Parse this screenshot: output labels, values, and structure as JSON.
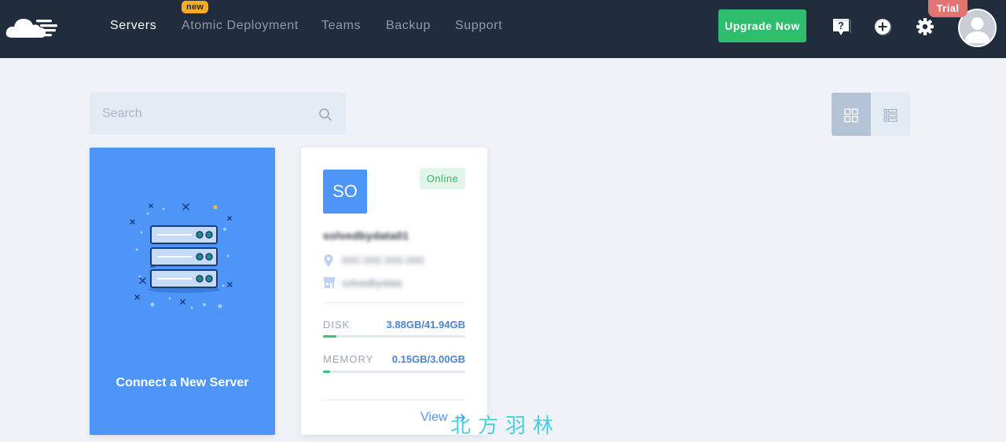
{
  "nav": {
    "items": [
      {
        "label": "Servers",
        "active": true
      },
      {
        "label": "Atomic Deployment",
        "badge": "new"
      },
      {
        "label": "Teams"
      },
      {
        "label": "Backup"
      },
      {
        "label": "Support"
      }
    ],
    "upgrade_label": "Upgrade Now",
    "icons": [
      "help-icon",
      "add-circle-icon",
      "gear-icon"
    ],
    "trial_badge": "Trial",
    "avatar_icon": "user-avatar-icon",
    "logo_icon": "cloud-logo"
  },
  "toolbar": {
    "search_placeholder": "Search",
    "search_icon": "search-icon",
    "views": [
      {
        "name": "grid-view",
        "icon": "grid-icon",
        "active": true
      },
      {
        "name": "list-view",
        "icon": "list-icon",
        "active": false
      }
    ]
  },
  "connect_card": {
    "label": "Connect a New Server",
    "icon": "server-rack-illustration"
  },
  "server_card": {
    "initials": "SO",
    "status": "Online",
    "name": "solvedbydata01",
    "ip": "000.000.000.000",
    "provider": "solvedbydata",
    "disk": {
      "label": "DISK",
      "value": "3.88GB/41.94GB",
      "fraction": 0.0925
    },
    "memory": {
      "label": "MEMORY",
      "value": "0.15GB/3.00GB",
      "fraction": 0.05
    },
    "view_label": "View",
    "colors": {
      "avatar": "#4d96f7",
      "status_text": "#37b872",
      "status_bg": "#e1f5e8",
      "progress": "#39c375"
    }
  },
  "watermark": "北方羽林",
  "colors": {
    "topbar": "#212c3d",
    "accent_blue": "#4d96f7",
    "upgrade_green": "#2dbd6d",
    "trial_red": "#e47474",
    "new_badge": "#f6ad1f",
    "page_bg": "#eff3f8"
  }
}
